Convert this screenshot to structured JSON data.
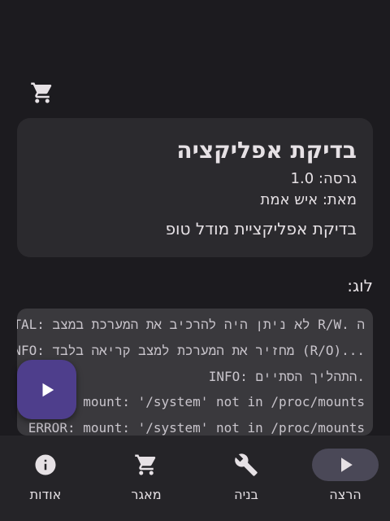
{
  "header": {
    "store_icon": "shopping-cart-icon"
  },
  "module": {
    "name": "בדיקת אפליקציה",
    "version": "גרסה: 1.0",
    "author": "מאת: איש אמת",
    "description": "בדיקת אפליקציית מודל טופ"
  },
  "log": {
    "label": "לוג:",
    "lines": [
      "FATAL: לא ניתן היה להרכיב את המערכת במצב R/W. ה",
      "INFO: מחזיר את המערכת למצב קריאה בלבד (R/O)...",
      "INFO: התהליך הסתיים.",
      "ERROR: mount: '/system' not in /proc/mounts",
      "ERROR: mount: '/system' not in /proc/mounts"
    ]
  },
  "fab": {
    "icon": "play-icon"
  },
  "nav": {
    "items": [
      {
        "label": "הרצה",
        "icon": "play-icon",
        "active": true
      },
      {
        "label": "בניה",
        "icon": "wrench-icon",
        "active": false
      },
      {
        "label": "מאגר",
        "icon": "shopping-cart-icon",
        "active": false
      },
      {
        "label": "אודות",
        "icon": "info-icon",
        "active": false
      }
    ]
  },
  "colors": {
    "background": "#1c1b1f",
    "card": "#2b2a2e",
    "log_box": "#3a393d",
    "fab": "#4e3e8c",
    "nav_bar": "#252428",
    "nav_active_pill": "#4a4857"
  }
}
